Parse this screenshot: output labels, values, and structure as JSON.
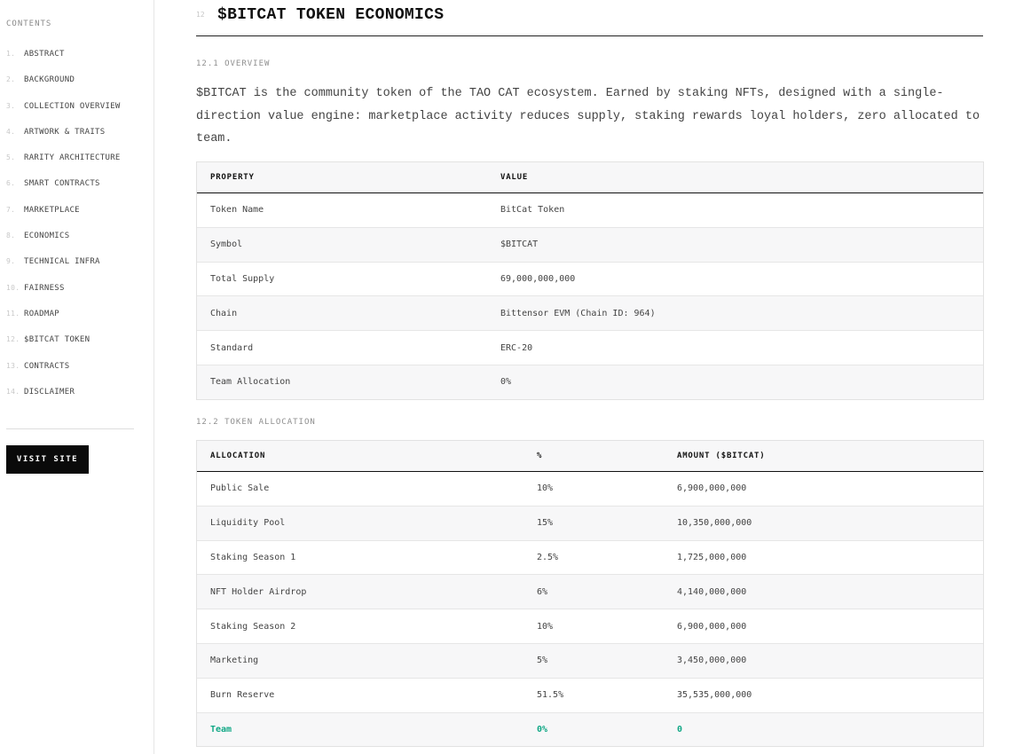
{
  "sidebar": {
    "heading": "CONTENTS",
    "items": [
      {
        "num": "1.",
        "label": "ABSTRACT"
      },
      {
        "num": "2.",
        "label": "BACKGROUND"
      },
      {
        "num": "3.",
        "label": "COLLECTION OVERVIEW"
      },
      {
        "num": "4.",
        "label": "ARTWORK & TRAITS"
      },
      {
        "num": "5.",
        "label": "RARITY ARCHITECTURE"
      },
      {
        "num": "6.",
        "label": "SMART CONTRACTS"
      },
      {
        "num": "7.",
        "label": "MARKETPLACE"
      },
      {
        "num": "8.",
        "label": "ECONOMICS"
      },
      {
        "num": "9.",
        "label": "TECHNICAL INFRA"
      },
      {
        "num": "10.",
        "label": "FAIRNESS"
      },
      {
        "num": "11.",
        "label": "ROADMAP"
      },
      {
        "num": "12.",
        "label": "$BITCAT TOKEN"
      },
      {
        "num": "13.",
        "label": "CONTRACTS"
      },
      {
        "num": "14.",
        "label": "DISCLAIMER"
      }
    ],
    "visit_button": "VISIT SITE"
  },
  "main": {
    "section_num": "12",
    "title": "$BITCAT TOKEN ECONOMICS",
    "overview": {
      "heading": "12.1 OVERVIEW",
      "paragraph": "$BITCAT is the community token of the TAO CAT ecosystem. Earned by staking NFTs, designed with a single-direction value engine: marketplace activity reduces supply, staking rewards loyal holders, zero allocated to team."
    },
    "properties_table": {
      "headers": [
        "PROPERTY",
        "VALUE"
      ],
      "rows": [
        [
          "Token Name",
          "BitCat Token"
        ],
        [
          "Symbol",
          "$BITCAT"
        ],
        [
          "Total Supply",
          "69,000,000,000"
        ],
        [
          "Chain",
          "Bittensor EVM (Chain ID: 964)"
        ],
        [
          "Standard",
          "ERC-20"
        ],
        [
          "Team Allocation",
          "0%"
        ]
      ]
    },
    "allocation": {
      "heading": "12.2 TOKEN ALLOCATION",
      "headers": [
        "ALLOCATION",
        "%",
        "AMOUNT ($BITCAT)"
      ],
      "rows": [
        [
          "Public Sale",
          "10%",
          "6,900,000,000"
        ],
        [
          "Liquidity Pool",
          "15%",
          "10,350,000,000"
        ],
        [
          "Staking Season 1",
          "2.5%",
          "1,725,000,000"
        ],
        [
          "NFT Holder Airdrop",
          "6%",
          "4,140,000,000"
        ],
        [
          "Staking Season 2",
          "10%",
          "6,900,000,000"
        ],
        [
          "Marketing",
          "5%",
          "3,450,000,000"
        ],
        [
          "Burn Reserve",
          "51.5%",
          "35,535,000,000"
        ],
        [
          "Team",
          "0%",
          "0"
        ]
      ],
      "highlight_color": "#12a886"
    }
  }
}
